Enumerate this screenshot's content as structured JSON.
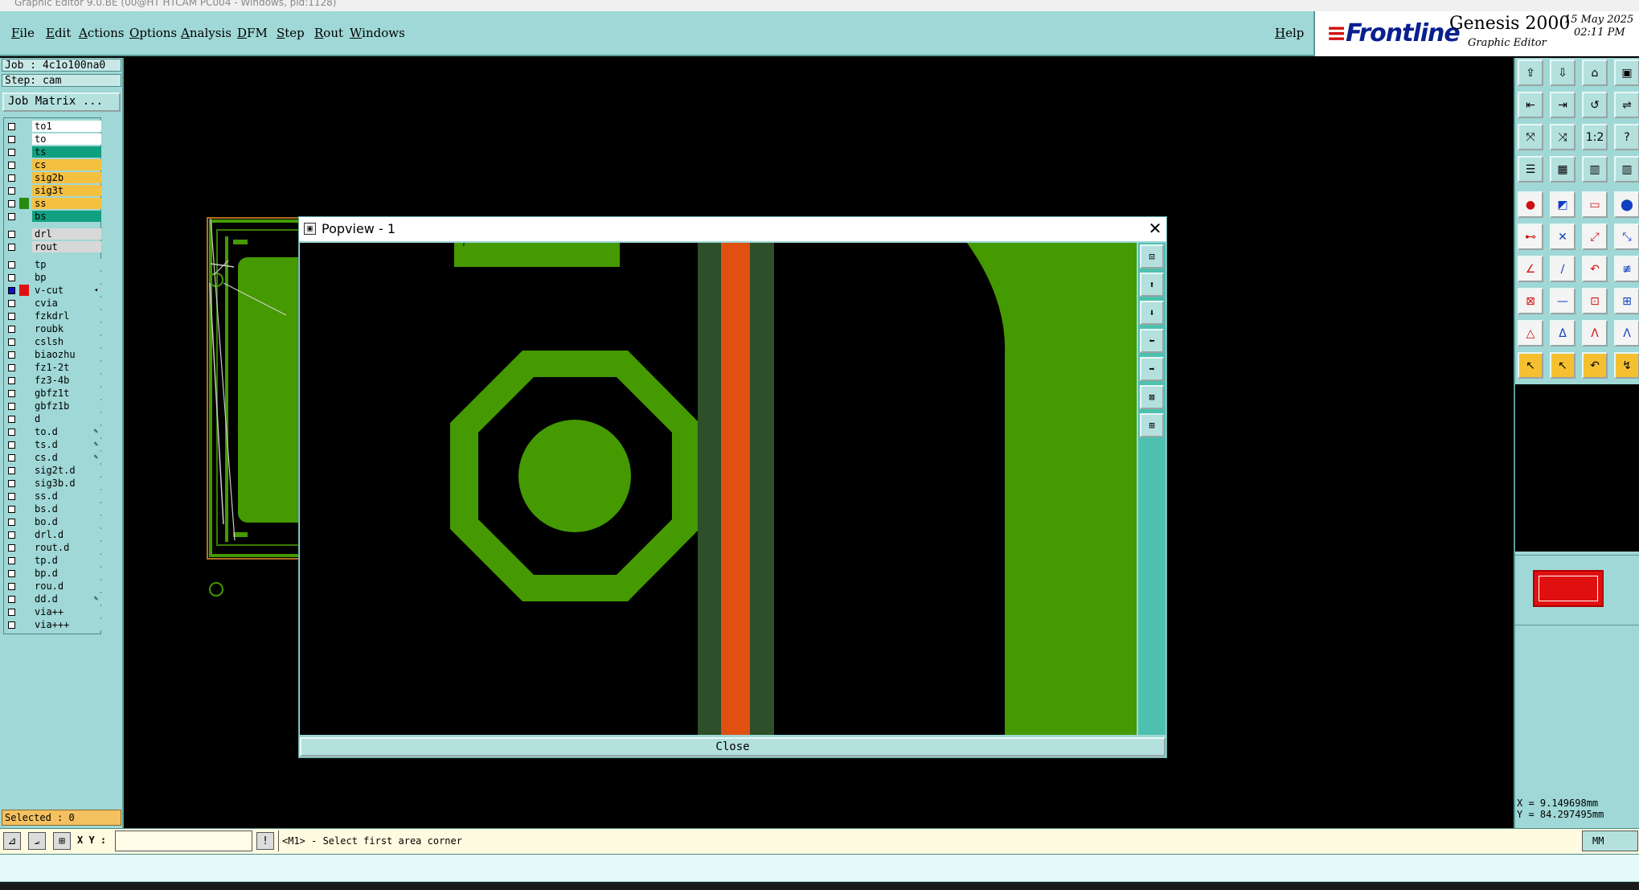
{
  "window": {
    "title": "Graphic Editor 9.0.BE (00@HT HTCAM PC004 - Windows, pid:1128)"
  },
  "menu": [
    "File",
    "Edit",
    "Actions",
    "Options",
    "Analysis",
    "DFM",
    "Step",
    "Rout",
    "Windows"
  ],
  "help_label": "Help",
  "branding": {
    "logo": "Frontline",
    "product": "Genesis 2000",
    "subtitle": "Graphic Editor",
    "date": "15 May 2025",
    "time": "02:11 PM"
  },
  "job": {
    "job_line": "Job : 4c1o100na0",
    "step_line": "Step: cam",
    "matrix_button": "Job Matrix ..."
  },
  "layers": [
    {
      "name": "to1",
      "bg": "#ffffff",
      "mark": ""
    },
    {
      "name": "to",
      "bg": "#ffffff",
      "mark": ""
    },
    {
      "name": "ts",
      "bg": "#10a080",
      "mark": ""
    },
    {
      "name": "cs",
      "bg": "#f4c040",
      "mark": ""
    },
    {
      "name": "sig2b",
      "bg": "#f4c040",
      "mark": ""
    },
    {
      "name": "sig3t",
      "bg": "#f4c040",
      "mark": ""
    },
    {
      "name": "ss",
      "bg": "#f4c040",
      "mark": "#2a8a10"
    },
    {
      "name": "bs",
      "bg": "#10a080",
      "mark": ""
    },
    {
      "name": "drl",
      "bg": "#d8d8d8",
      "mark": "",
      "gap": true
    },
    {
      "name": "rout",
      "bg": "#d8d8d8",
      "mark": ""
    },
    {
      "name": "tp",
      "bg": "#9fd8d6",
      "mark": "",
      "gap": true
    },
    {
      "name": "bp",
      "bg": "#9fd8d6",
      "mark": ""
    },
    {
      "name": "v-cut",
      "bg": "#9fd8d6",
      "mark": "#e01010",
      "active": true,
      "extra": "◂"
    },
    {
      "name": "cvia",
      "bg": "#9fd8d6",
      "mark": ""
    },
    {
      "name": "fzkdrl",
      "bg": "#9fd8d6",
      "mark": ""
    },
    {
      "name": "roubk",
      "bg": "#9fd8d6",
      "mark": ""
    },
    {
      "name": "cslsh",
      "bg": "#9fd8d6",
      "mark": ""
    },
    {
      "name": "biaozhu",
      "bg": "#9fd8d6",
      "mark": ""
    },
    {
      "name": "fz1-2t",
      "bg": "#9fd8d6",
      "mark": ""
    },
    {
      "name": "fz3-4b",
      "bg": "#9fd8d6",
      "mark": ""
    },
    {
      "name": "gbfz1t",
      "bg": "#9fd8d6",
      "mark": ""
    },
    {
      "name": "gbfz1b",
      "bg": "#9fd8d6",
      "mark": ""
    },
    {
      "name": "d",
      "bg": "#9fd8d6",
      "mark": ""
    },
    {
      "name": "to.d",
      "bg": "#9fd8d6",
      "mark": "",
      "extra": "✎"
    },
    {
      "name": "ts.d",
      "bg": "#9fd8d6",
      "mark": "",
      "extra": "✎"
    },
    {
      "name": "cs.d",
      "bg": "#9fd8d6",
      "mark": "",
      "extra": "✎"
    },
    {
      "name": "sig2t.d",
      "bg": "#9fd8d6",
      "mark": ""
    },
    {
      "name": "sig3b.d",
      "bg": "#9fd8d6",
      "mark": ""
    },
    {
      "name": "ss.d",
      "bg": "#9fd8d6",
      "mark": ""
    },
    {
      "name": "bs.d",
      "bg": "#9fd8d6",
      "mark": ""
    },
    {
      "name": "bo.d",
      "bg": "#9fd8d6",
      "mark": ""
    },
    {
      "name": "drl.d",
      "bg": "#9fd8d6",
      "mark": ""
    },
    {
      "name": "rout.d",
      "bg": "#9fd8d6",
      "mark": ""
    },
    {
      "name": "tp.d",
      "bg": "#9fd8d6",
      "mark": ""
    },
    {
      "name": "bp.d",
      "bg": "#9fd8d6",
      "mark": ""
    },
    {
      "name": "rou.d",
      "bg": "#9fd8d6",
      "mark": ""
    },
    {
      "name": "dd.d",
      "bg": "#9fd8d6",
      "mark": "",
      "extra": "✎"
    },
    {
      "name": "via++",
      "bg": "#9fd8d6",
      "mark": ""
    },
    {
      "name": "via+++",
      "bg": "#9fd8d6",
      "mark": ""
    }
  ],
  "selected": "Selected : 0",
  "popview": {
    "title": "Popview - 1",
    "close_button": "Close"
  },
  "status": {
    "xy_label": "X Y :",
    "xy_value": "",
    "prompt": "<M1> - Select first area corner",
    "units": "MM"
  },
  "coords": {
    "x": "X = 9.149698mm",
    "y": "Y = 84.297495mm"
  },
  "colors": {
    "panel": "#9fd8d6",
    "copper": "#449a00",
    "vcut": "#e05010",
    "selected_bg": "#f4c060"
  }
}
